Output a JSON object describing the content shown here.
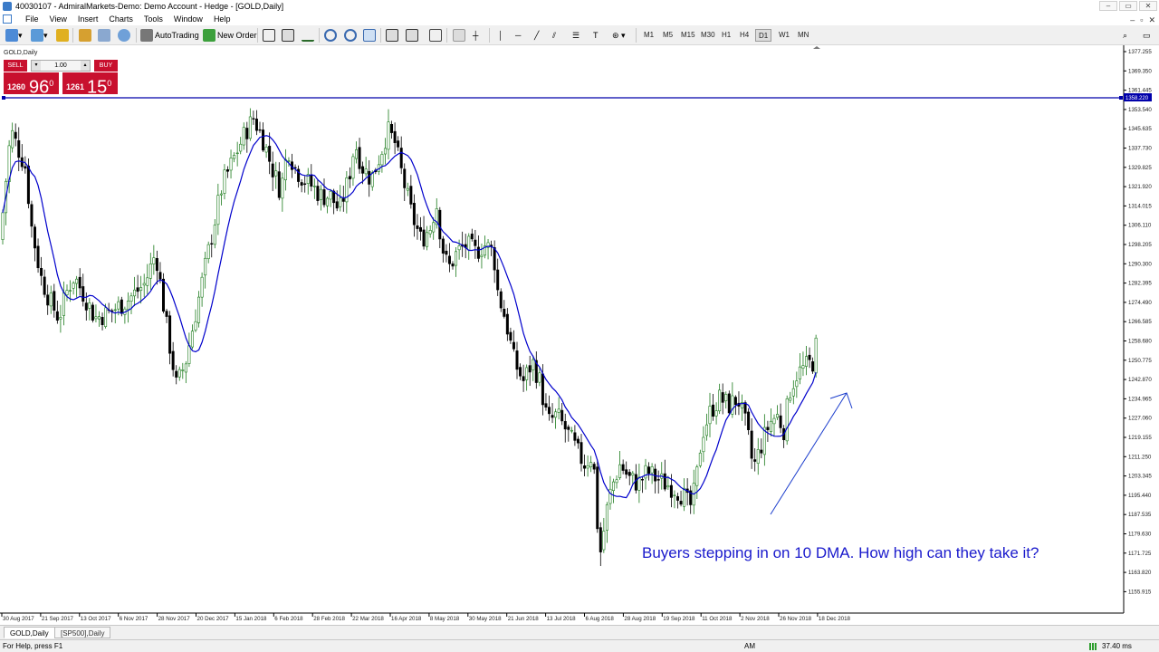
{
  "window": {
    "title": "40030107 - AdmiralMarkets-Demo: Demo Account - Hedge - [GOLD,Daily]"
  },
  "menu": [
    "File",
    "View",
    "Insert",
    "Charts",
    "Tools",
    "Window",
    "Help"
  ],
  "toolbar": {
    "autotrading": "AutoTrading",
    "new_order": "New Order",
    "timeframes": [
      "M1",
      "M5",
      "M15",
      "M30",
      "H1",
      "H4",
      "D1",
      "W1",
      "MN"
    ],
    "active_timeframe": "D1"
  },
  "chart": {
    "symbol_label": "GOLD,Daily",
    "trade": {
      "sell": "SELL",
      "buy": "BUY",
      "lot": "1.00",
      "bid_small": "1260",
      "bid_big": "96",
      "bid_sup": "0",
      "ask_small": "1261",
      "ask_big": "15",
      "ask_sup": "0"
    },
    "annotation": "Buyers stepping in on 10 DMA. How high can they take it?",
    "hline_label": "1358.220",
    "colors": {
      "up_candle": "#1a7a1a",
      "down_candle": "#000000",
      "ma_line": "#0000cc",
      "hline": "#0000aa",
      "annotation": "#1a1acc",
      "sell_buy_bg": "#c8102e"
    }
  },
  "chart_data": {
    "type": "candlestick",
    "title": "GOLD,Daily",
    "ylim": [
      1155.0,
      1377.3
    ],
    "y_ticks": [
      "1377.255",
      "1369.350",
      "1361.445",
      "1353.540",
      "1345.635",
      "1337.730",
      "1329.825",
      "1321.920",
      "1314.015",
      "1306.110",
      "1298.205",
      "1290.300",
      "1282.395",
      "1274.490",
      "1266.585",
      "1258.680",
      "1250.775",
      "1242.870",
      "1234.965",
      "1227.060",
      "1219.155",
      "1211.250",
      "1203.345",
      "1195.440",
      "1187.535",
      "1179.630",
      "1171.725",
      "1163.820",
      "1155.915"
    ],
    "x_ticks": [
      "30 Aug 2017",
      "21 Sep 2017",
      "13 Oct 2017",
      "6 Nov 2017",
      "28 Nov 2017",
      "20 Dec 2017",
      "15 Jan 2018",
      "6 Feb 2018",
      "28 Feb 2018",
      "22 Mar 2018",
      "16 Apr 2018",
      "8 May 2018",
      "30 May 2018",
      "21 Jun 2018",
      "13 Jul 2018",
      "6 Aug 2018",
      "28 Aug 2018",
      "19 Sep 2018",
      "11 Oct 2018",
      "2 Nov 2018",
      "26 Nov 2018",
      "18 Dec 2018"
    ],
    "horizontal_line": 1358.22,
    "series": [
      {
        "name": "Moving Average",
        "period": 10
      }
    ],
    "price_path": [
      [
        0,
        1300
      ],
      [
        12,
        1345
      ],
      [
        28,
        1330
      ],
      [
        35,
        1305
      ],
      [
        45,
        1285
      ],
      [
        55,
        1275
      ],
      [
        65,
        1268
      ],
      [
        75,
        1280
      ],
      [
        82,
        1285
      ],
      [
        92,
        1278
      ],
      [
        105,
        1268
      ],
      [
        120,
        1270
      ],
      [
        140,
        1275
      ],
      [
        160,
        1282
      ],
      [
        172,
        1295
      ],
      [
        185,
        1262
      ],
      [
        195,
        1240
      ],
      [
        205,
        1250
      ],
      [
        215,
        1268
      ],
      [
        230,
        1295
      ],
      [
        245,
        1322
      ],
      [
        260,
        1335
      ],
      [
        272,
        1345
      ],
      [
        280,
        1350
      ],
      [
        290,
        1342
      ],
      [
        300,
        1330
      ],
      [
        310,
        1320
      ],
      [
        318,
        1338
      ],
      [
        325,
        1330
      ],
      [
        335,
        1325
      ],
      [
        345,
        1322
      ],
      [
        355,
        1318
      ],
      [
        365,
        1318
      ],
      [
        375,
        1312
      ],
      [
        385,
        1325
      ],
      [
        392,
        1340
      ],
      [
        400,
        1330
      ],
      [
        410,
        1325
      ],
      [
        420,
        1335
      ],
      [
        428,
        1345
      ],
      [
        436,
        1340
      ],
      [
        445,
        1325
      ],
      [
        455,
        1310
      ],
      [
        465,
        1300
      ],
      [
        475,
        1305
      ],
      [
        482,
        1315
      ],
      [
        488,
        1298
      ],
      [
        495,
        1288
      ],
      [
        505,
        1295
      ],
      [
        515,
        1298
      ],
      [
        525,
        1295
      ],
      [
        535,
        1298
      ],
      [
        545,
        1295
      ],
      [
        550,
        1278
      ],
      [
        558,
        1268
      ],
      [
        568,
        1250
      ],
      [
        578,
        1242
      ],
      [
        588,
        1250
      ],
      [
        596,
        1242
      ],
      [
        605,
        1225
      ],
      [
        615,
        1228
      ],
      [
        625,
        1222
      ],
      [
        635,
        1215
      ],
      [
        645,
        1208
      ],
      [
        655,
        1212
      ],
      [
        660,
        1182
      ],
      [
        664,
        1170
      ],
      [
        668,
        1185
      ],
      [
        675,
        1198
      ],
      [
        685,
        1208
      ],
      [
        695,
        1202
      ],
      [
        705,
        1200
      ],
      [
        715,
        1205
      ],
      [
        725,
        1202
      ],
      [
        735,
        1200
      ],
      [
        745,
        1198
      ],
      [
        755,
        1195
      ],
      [
        762,
        1190
      ],
      [
        768,
        1198
      ],
      [
        775,
        1220
      ],
      [
        785,
        1230
      ],
      [
        795,
        1235
      ],
      [
        805,
        1232
      ],
      [
        815,
        1235
      ],
      [
        825,
        1222
      ],
      [
        832,
        1206
      ],
      [
        840,
        1215
      ],
      [
        850,
        1225
      ],
      [
        858,
        1228
      ],
      [
        866,
        1222
      ],
      [
        872,
        1238
      ],
      [
        880,
        1245
      ],
      [
        890,
        1248
      ],
      [
        898,
        1250
      ],
      [
        904,
        1262
      ]
    ]
  }
}
